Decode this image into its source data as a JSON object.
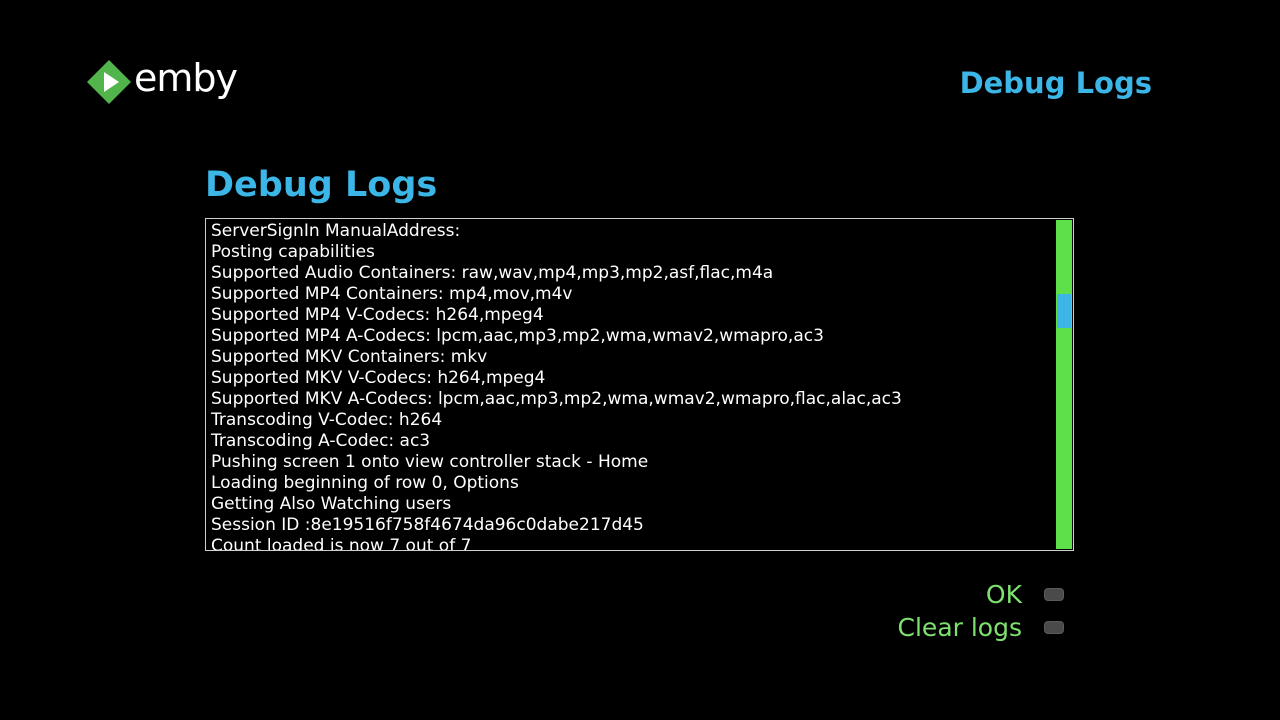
{
  "brand": {
    "name": "emby",
    "logo_icon": "emby-logo-icon",
    "logo_color": "#52b54b"
  },
  "header": {
    "title": "Debug Logs"
  },
  "page": {
    "title": "Debug Logs"
  },
  "log": {
    "lines": [
      "ServerSignIn ManualAddress:",
      "Posting capabilities",
      "Supported Audio Containers: raw,wav,mp4,mp3,mp2,asf,flac,m4a",
      "Supported MP4 Containers: mp4,mov,m4v",
      "Supported MP4 V-Codecs: h264,mpeg4",
      "Supported MP4 A-Codecs: lpcm,aac,mp3,mp2,wma,wmav2,wmapro,ac3",
      "Supported MKV Containers: mkv",
      "Supported MKV V-Codecs: h264,mpeg4",
      "Supported MKV A-Codecs: lpcm,aac,mp3,mp2,wma,wmav2,wmapro,flac,alac,ac3",
      "Transcoding V-Codec: h264",
      "Transcoding A-Codec: ac3",
      "Pushing screen 1 onto view controller stack - Home",
      "Loading beginning of row 0, Options",
      "Getting Also Watching users",
      "Session ID :8e19516f758f4674da96c0dabe217d45",
      "Count loaded is now 7 out of 7"
    ],
    "scroll_position": 0.25,
    "colors": {
      "track": "#5de04a",
      "thumb": "#3bb6e6"
    }
  },
  "menu": {
    "items": [
      {
        "label": "OK"
      },
      {
        "label": "Clear logs"
      }
    ]
  },
  "colors": {
    "accent": "#3bb6e6",
    "menu_text": "#7ee06e",
    "background": "#000000"
  }
}
